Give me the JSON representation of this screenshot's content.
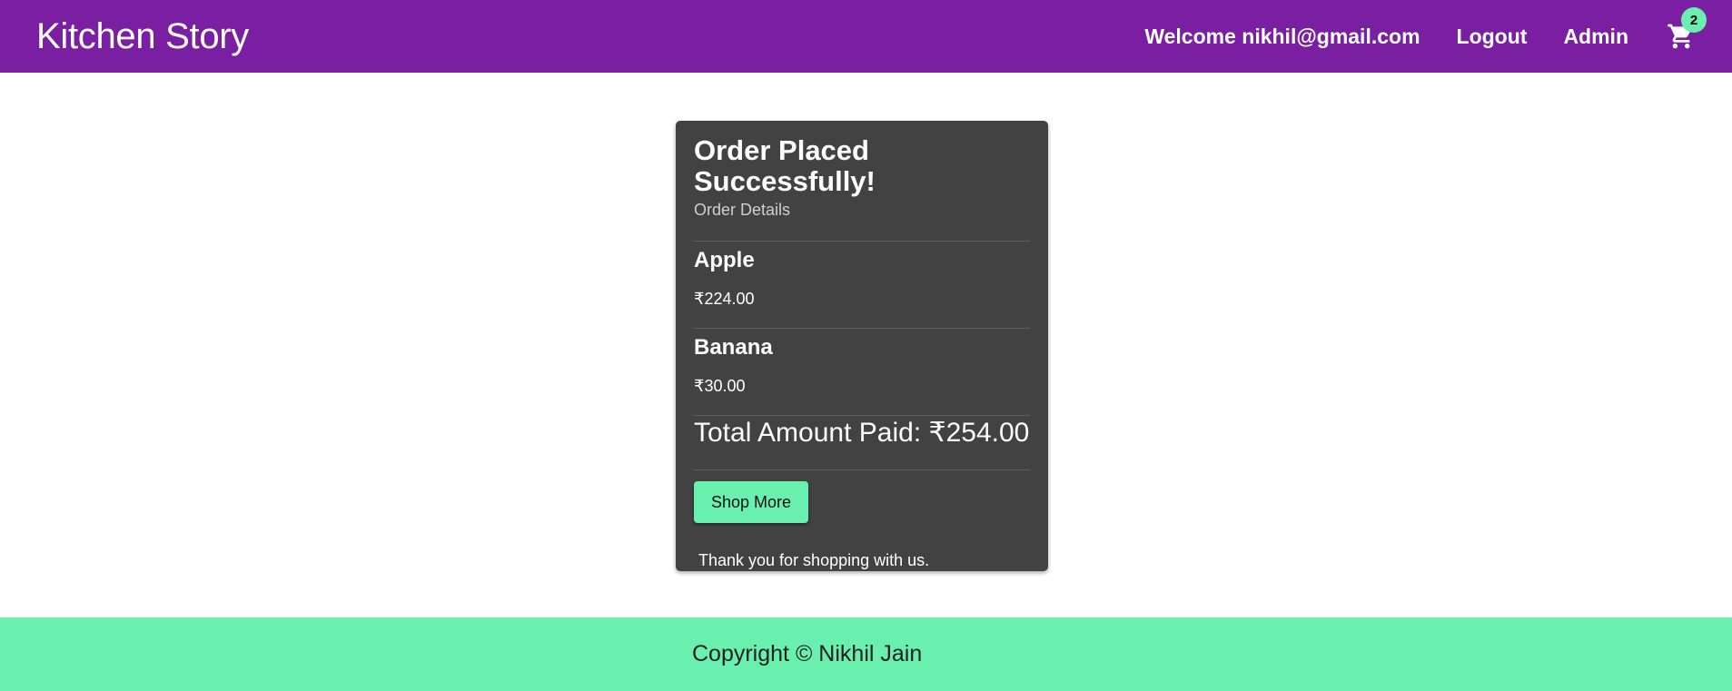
{
  "navbar": {
    "brand": "Kitchen Story",
    "welcome": "Welcome nikhil@gmail.com",
    "logout": "Logout",
    "admin": "Admin",
    "cart_count": "2",
    "cart_icon": "shopping-cart-icon",
    "background": "#7b1fa2"
  },
  "order": {
    "title": "Order Placed Successfully!",
    "subtitle": "Order Details",
    "items": [
      {
        "name": "Apple",
        "price": "₹224.00"
      },
      {
        "name": "Banana",
        "price": "₹30.00"
      }
    ],
    "total": "Total Amount Paid: ₹254.00",
    "shop_more": "Shop More",
    "thanks": "Thank you for shopping with us.",
    "card_background": "#424242",
    "accent": "#69f0ae"
  },
  "footer": {
    "text": "Copyright © Nikhil Jain",
    "background": "#69f0ae"
  }
}
